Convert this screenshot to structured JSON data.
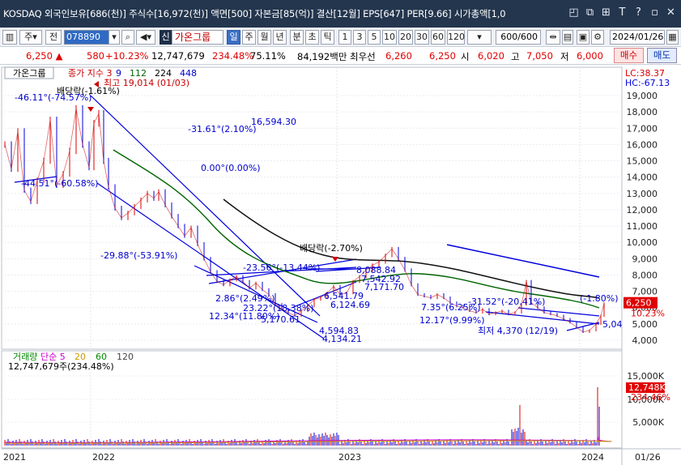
{
  "titlebar": {
    "text": "KOSDAQ 외국인보유[686(천)] 주식수[16,972(천)] 액면[500] 자본금[85(억)] 결산[12월] EPS[647] PER[9.66] 시가총액[1,0",
    "icons": [
      "restore-icon",
      "copy-icon",
      "grid-icon",
      "help-icon",
      "min-icon",
      "close-icon"
    ],
    "icon_glyphs": [
      "◰",
      "⧉",
      "⊞",
      "T",
      "?",
      "▫",
      "✕"
    ]
  },
  "toolbar": {
    "market": "주",
    "prev": "전",
    "code": "078890",
    "badge": "신",
    "stock_name": "가온그룹",
    "periods": [
      "일",
      "주",
      "월",
      "년",
      "분",
      "초",
      "틱"
    ],
    "intervals": [
      "1",
      "3",
      "5",
      "10",
      "20",
      "30",
      "60",
      "120"
    ],
    "count": "600/600",
    "date": "2024/01/26"
  },
  "quote": {
    "price": "6,250",
    "arrow": "▲",
    "change": "580",
    "change_pct": "+10.23%",
    "volume": "12,747,679",
    "vol_ratio": "234.48%",
    "turnover": "75.11%",
    "amount": "84,192백만",
    "pref_label": "최우선",
    "pref_price": "6,260",
    "ask": "6,250",
    "open_label": "시",
    "open": "6,020",
    "high_label": "고",
    "high": "7,050",
    "low_label": "저",
    "low": "6,000",
    "buy": "매수",
    "sell": "매도"
  },
  "chart": {
    "panel_title": "가온그룹",
    "legend": [
      {
        "text": "종가 지수 3",
        "color": "#cc0000"
      },
      {
        "text": "9",
        "color": "#0000cc"
      },
      {
        "text": "112",
        "color": "#006600"
      },
      {
        "text": "224",
        "color": "#000000"
      },
      {
        "text": "448",
        "color": "#0000cc"
      }
    ],
    "lc": "LC:38.37",
    "hc": "HC:-67.13",
    "price_ticks": [
      "19,000",
      "18,000",
      "17,000",
      "16,000",
      "15,000",
      "14,000",
      "13,000",
      "12,000",
      "11,000",
      "10,000",
      "9,000",
      "8,000",
      "7,000",
      "6,000",
      "5,000",
      "4,000"
    ],
    "price_tick_values": [
      19000,
      18000,
      17000,
      16000,
      15000,
      14000,
      13000,
      12000,
      11000,
      10000,
      9000,
      8000,
      7000,
      6000,
      5000,
      4000
    ],
    "current_price_tag": "6,250",
    "current_pct_tag": "10.23%",
    "annotations": [
      {
        "text": "최고 19,014 (01/03)",
        "color": "#cc0000"
      },
      {
        "text": "배당락(-1.61%)",
        "color": "#000000"
      },
      {
        "text": "-46.11°(-74.57%)",
        "color": "#0000cc"
      },
      {
        "text": "-31.61°(2.10%)",
        "color": "#0000cc"
      },
      {
        "text": "16,594.30",
        "color": "#0000cc"
      },
      {
        "text": "0.00°(0.00%)",
        "color": "#0000cc"
      },
      {
        "text": "-44.51°(-60.58%)",
        "color": "#0000cc"
      },
      {
        "text": "-29.88°(-53.91%)",
        "color": "#0000cc"
      },
      {
        "text": "배당락(-2.70%)",
        "color": "#000000"
      },
      {
        "text": "-23.56°(-13.44%)",
        "color": "#0000cc"
      },
      {
        "text": "8,088.84",
        "color": "#0000cc"
      },
      {
        "text": "7,542.92",
        "color": "#0000cc"
      },
      {
        "text": "7,171.70",
        "color": "#0000cc"
      },
      {
        "text": "6,541.79",
        "color": "#0000cc"
      },
      {
        "text": "6,124.69",
        "color": "#0000cc"
      },
      {
        "text": "2.86°(2.49%)",
        "color": "#0000cc"
      },
      {
        "text": "23.22°(18.38%)",
        "color": "#0000cc"
      },
      {
        "text": "12.34°(11.80%)",
        "color": "#0000cc"
      },
      {
        "text": "5,170.61",
        "color": "#0000cc"
      },
      {
        "text": "4,594.83",
        "color": "#0000cc"
      },
      {
        "text": "4,134.21",
        "color": "#0000cc"
      },
      {
        "text": "7.35°(6.25%)",
        "color": "#0000cc"
      },
      {
        "text": "12.17°(9.99%)",
        "color": "#0000cc"
      },
      {
        "text": "-31.52°(-20.41%)",
        "color": "#0000cc"
      },
      {
        "text": "(-1.80%)",
        "color": "#0000cc"
      },
      {
        "text": "최저 4,370 (12/19)",
        "color": "#0000cc"
      },
      {
        "text": "5,04",
        "color": "#0000cc"
      }
    ],
    "volume_legend": [
      {
        "text": "거래량",
        "color": "#008800"
      },
      {
        "text": "단순 5",
        "color": "#cc00cc"
      },
      {
        "text": "20",
        "color": "#cc9900"
      },
      {
        "text": "60",
        "color": "#008800"
      },
      {
        "text": "120",
        "color": "#444444"
      }
    ],
    "volume_value": "12,747,679주(234.48%)",
    "volume_ticks": [
      "15,000K",
      "10,000K",
      "5,000K"
    ],
    "volume_tags": [
      "12,748K",
      "234.46%"
    ],
    "date_labels": [
      "2021",
      "2022",
      "2023",
      "2024",
      "01/26"
    ]
  },
  "chart_data": {
    "type": "line",
    "title": "가온그룹",
    "series": [
      {
        "name": "종가",
        "points": [
          [
            0,
            16000
          ],
          [
            8,
            14500
          ],
          [
            16,
            16800
          ],
          [
            24,
            13200
          ],
          [
            32,
            12500
          ],
          [
            40,
            13800
          ],
          [
            48,
            15000
          ],
          [
            56,
            17500
          ],
          [
            64,
            13500
          ],
          [
            72,
            14200
          ],
          [
            80,
            15600
          ],
          [
            88,
            18200
          ],
          [
            96,
            16000
          ],
          [
            104,
            14600
          ],
          [
            110,
            17300
          ],
          [
            116,
            17900
          ],
          [
            122,
            15000
          ],
          [
            128,
            13400
          ],
          [
            136,
            12100
          ],
          [
            144,
            11500
          ],
          [
            152,
            11800
          ],
          [
            160,
            12200
          ],
          [
            168,
            12600
          ],
          [
            176,
            13000
          ],
          [
            184,
            12700
          ],
          [
            190,
            13100
          ],
          [
            198,
            12300
          ],
          [
            206,
            11600
          ],
          [
            214,
            11000
          ],
          [
            222,
            10400
          ],
          [
            230,
            10900
          ],
          [
            238,
            9900
          ],
          [
            246,
            9000
          ],
          [
            254,
            8200
          ],
          [
            262,
            7600
          ],
          [
            270,
            7400
          ],
          [
            278,
            7700
          ],
          [
            286,
            7900
          ],
          [
            294,
            7600
          ],
          [
            302,
            7200
          ],
          [
            310,
            7500
          ],
          [
            318,
            7100
          ],
          [
            326,
            6800
          ],
          [
            334,
            6200
          ],
          [
            342,
            5900
          ],
          [
            350,
            5700
          ],
          [
            358,
            5500
          ],
          [
            366,
            5800
          ],
          [
            374,
            6100
          ],
          [
            382,
            6500
          ],
          [
            390,
            6600
          ],
          [
            398,
            6900
          ],
          [
            406,
            7300
          ],
          [
            414,
            6800
          ],
          [
            422,
            6900
          ],
          [
            430,
            7600
          ],
          [
            438,
            7900
          ],
          [
            446,
            8300
          ],
          [
            454,
            8600
          ],
          [
            462,
            8800
          ],
          [
            470,
            9200
          ],
          [
            478,
            9600
          ],
          [
            486,
            9000
          ],
          [
            494,
            8300
          ],
          [
            502,
            7400
          ],
          [
            510,
            6800
          ],
          [
            518,
            6700
          ],
          [
            526,
            6600
          ],
          [
            534,
            6800
          ],
          [
            542,
            6600
          ],
          [
            550,
            6300
          ],
          [
            558,
            6100
          ],
          [
            566,
            6000
          ],
          [
            574,
            5800
          ],
          [
            582,
            5700
          ],
          [
            590,
            5900
          ],
          [
            598,
            5600
          ],
          [
            606,
            5700
          ],
          [
            614,
            5800
          ],
          [
            622,
            5600
          ],
          [
            630,
            5700
          ],
          [
            638,
            6200
          ],
          [
            644,
            7600
          ],
          [
            650,
            6300
          ],
          [
            658,
            6000
          ],
          [
            666,
            5700
          ],
          [
            674,
            5600
          ],
          [
            682,
            5500
          ],
          [
            690,
            5300
          ],
          [
            698,
            5100
          ],
          [
            706,
            4800
          ],
          [
            714,
            4500
          ],
          [
            722,
            4600
          ],
          [
            730,
            5000
          ],
          [
            736,
            5500
          ],
          [
            740,
            6250
          ]
        ]
      }
    ],
    "ylim": [
      3600,
      19600
    ]
  }
}
